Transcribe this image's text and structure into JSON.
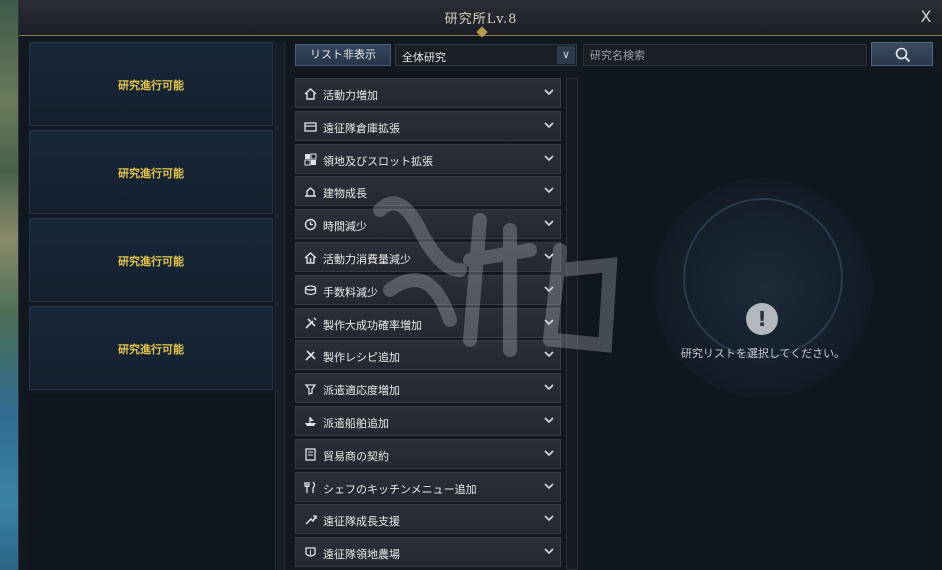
{
  "window": {
    "title": "研究所Lv.8",
    "close_label": "X"
  },
  "slots": [
    {
      "label": "研究進行可能"
    },
    {
      "label": "研究進行可能"
    },
    {
      "label": "研究進行可能"
    },
    {
      "label": "研究進行可能"
    }
  ],
  "controls": {
    "hide_list_label": "リスト非表示",
    "filter_value": "全体研究",
    "search_placeholder": "研究名検索"
  },
  "research_list": [
    {
      "label": "活動力増加",
      "icon": "home-up-icon"
    },
    {
      "label": "遠征隊倉庫拡張",
      "icon": "storage-icon"
    },
    {
      "label": "領地及びスロット拡張",
      "icon": "grid-icon"
    },
    {
      "label": "建物成長",
      "icon": "building-icon"
    },
    {
      "label": "時間減少",
      "icon": "clock-icon"
    },
    {
      "label": "活動力消費量減少",
      "icon": "home-down-icon"
    },
    {
      "label": "手数料減少",
      "icon": "coins-icon"
    },
    {
      "label": "製作大成功確率増加",
      "icon": "tools-up-icon"
    },
    {
      "label": "製作レシピ追加",
      "icon": "tools-icon"
    },
    {
      "label": "派遣適応度増加",
      "icon": "dispatch-icon"
    },
    {
      "label": "派遣船舶追加",
      "icon": "ship-icon"
    },
    {
      "label": "貿易商の契約",
      "icon": "contract-icon"
    },
    {
      "label": "シェフのキッチンメニュー追加",
      "icon": "cutlery-icon"
    },
    {
      "label": "遠征隊成長支援",
      "icon": "growth-icon"
    },
    {
      "label": "遠征隊領地農場",
      "icon": "farm-icon"
    }
  ],
  "detail": {
    "message": "研究リストを選択してください。"
  },
  "colors": {
    "slot_text": "#e3c44b",
    "accent": "#b89a55"
  }
}
